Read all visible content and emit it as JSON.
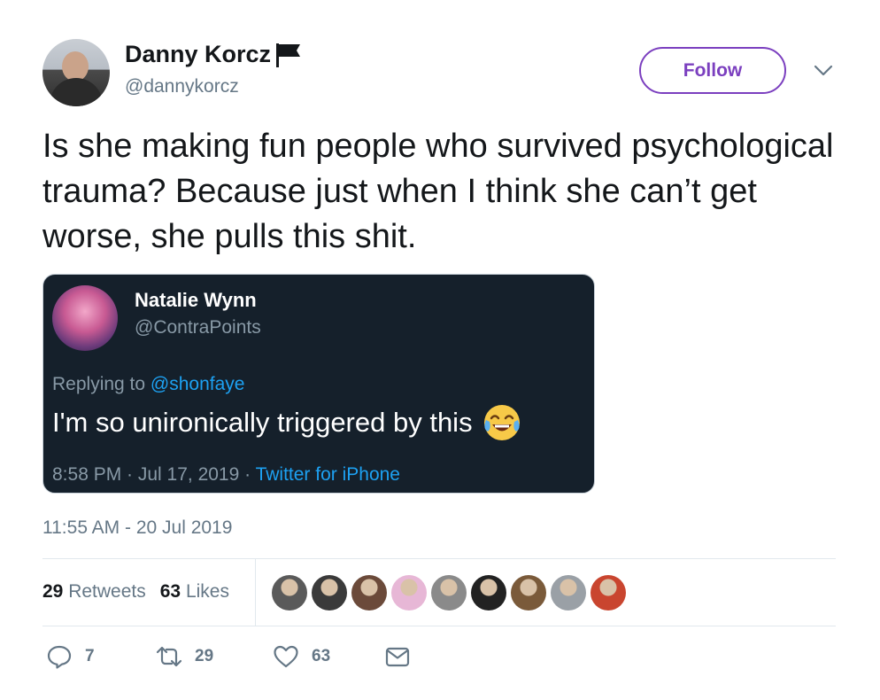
{
  "author": {
    "display_name": "Danny Korcz",
    "handle": "@dannykorcz",
    "follow_label": "Follow"
  },
  "tweet_text": "Is she making fun people who survived psychological trauma? Because just when I think she can’t get worse, she pulls this shit.",
  "embedded_tweet": {
    "display_name": "Natalie Wynn",
    "handle": "@ContraPoints",
    "replying_prefix": "Replying to ",
    "replying_to": "@shonfaye",
    "text": "I'm so unironically triggered by this",
    "meta_prefix": "8:58 PM · Jul 17, 2019 · ",
    "source": "Twitter for iPhone"
  },
  "timestamp": "11:55 AM - 20 Jul 2019",
  "stats": {
    "retweets_count": "29",
    "retweets_label": "Retweets",
    "likes_count": "63",
    "likes_label": "Likes"
  },
  "likers": [
    {
      "color": "#5a5a5a"
    },
    {
      "color": "#3a3a3a"
    },
    {
      "color": "#6b4a3a"
    },
    {
      "color": "#e7b7d6"
    },
    {
      "color": "#8a8a8a"
    },
    {
      "color": "#222222"
    },
    {
      "color": "#7a5a3a"
    },
    {
      "color": "#9aa0a6"
    },
    {
      "color": "#c9452f"
    }
  ],
  "actions": {
    "reply_count": "7",
    "retweet_count": "29",
    "like_count": "63"
  },
  "colors": {
    "follow_accent": "#7b3fbf",
    "link_blue": "#1da1f2",
    "secondary_text": "#657786",
    "embed_background": "#15202b"
  },
  "icons": [
    "flag-icon",
    "chevron-down-icon",
    "laughing-emoji-icon",
    "reply-icon",
    "retweet-icon",
    "heart-icon",
    "message-icon"
  ]
}
